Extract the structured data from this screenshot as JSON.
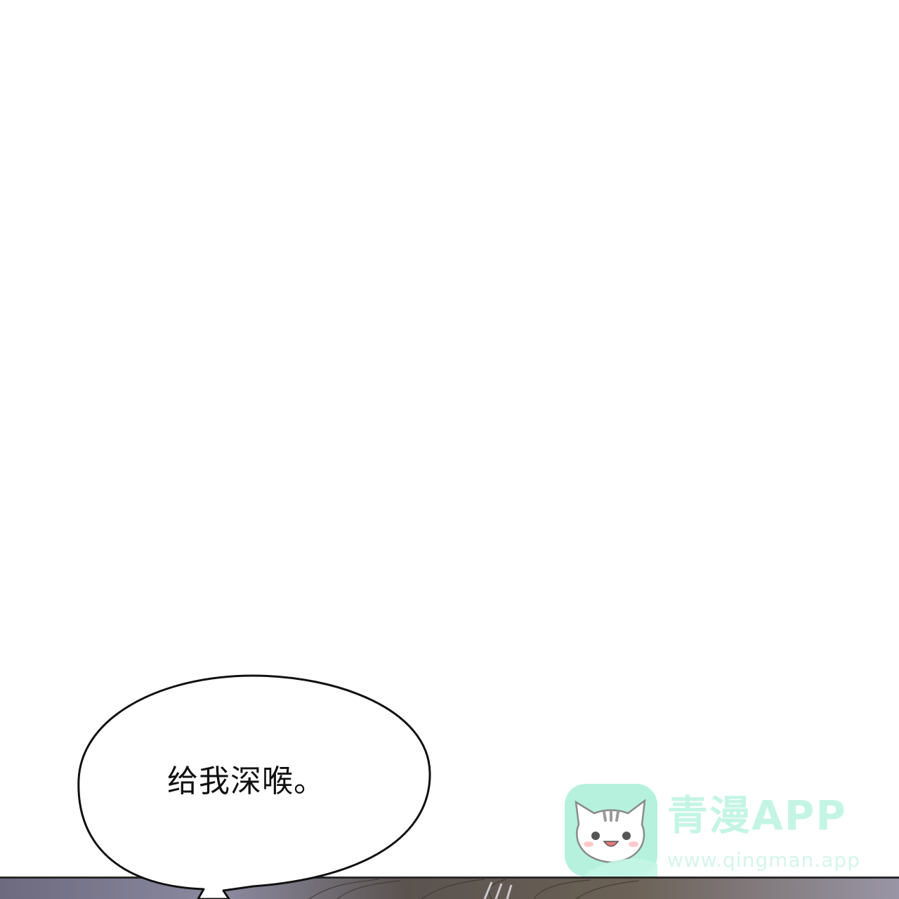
{
  "speech_bubble": {
    "text": "给我深喉。"
  },
  "watermark": {
    "title": "青漫APP",
    "url": "www.qingman.app",
    "icon": "cat-app-icon",
    "accent_color": "#a8efd6"
  },
  "colors": {
    "background": "#ffffff",
    "bubble_outline": "#111111",
    "bottom_strip": "#5e5a66"
  }
}
